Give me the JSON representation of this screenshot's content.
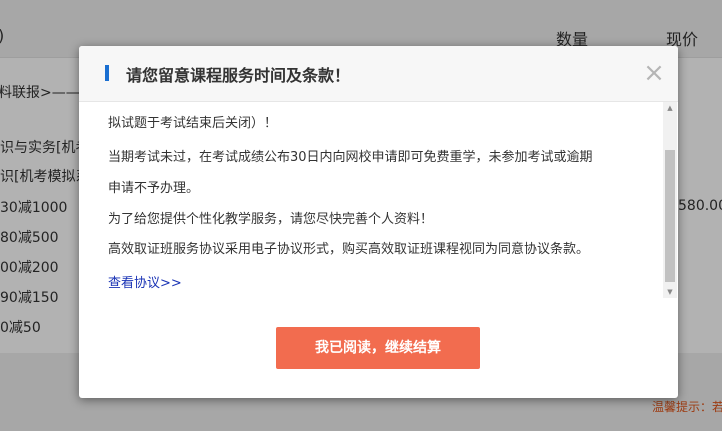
{
  "background": {
    "header": {
      "col_paren": ")",
      "col_quantity": "数量",
      "col_price": "现价"
    },
    "subject": "料联报>——",
    "lines": [
      "识与实务[机考",
      "识[机考模拟系"
    ],
    "coupons": [
      "30减1000",
      "80减500",
      "00减200",
      "90减150",
      "0减50"
    ],
    "price": "580.00",
    "tip": "温馨提示：若"
  },
  "modal": {
    "title": "请您留意课程服务时间及条款！",
    "close_symbol": "×",
    "paragraphs": [
      "拟试题于考试结束后关闭）！",
      "当期考试未过，在考试成绩公布30日内向网校申请即可免费重学，未参加考试或逾期",
      "申请不予办理。",
      "为了给您提供个性化教学服务，请您尽快完善个人资料！",
      "高效取证班服务协议采用电子协议形式，购买高效取证班课程视同为同意协议条款。"
    ],
    "link_label": "查看协议>>",
    "confirm_label": "我已阅读，继续结算",
    "accent_color": "#1a6fd1",
    "button_color": "#f26c4f"
  }
}
